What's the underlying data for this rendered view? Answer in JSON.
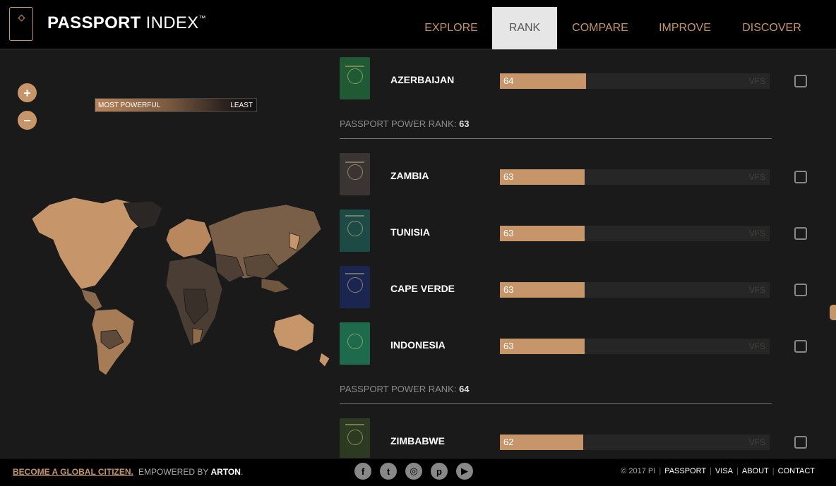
{
  "header": {
    "logo_bold": "PASSPORT",
    "logo_light": "INDEX",
    "logo_tm": "™",
    "nav": [
      {
        "label": "EXPLORE",
        "active": false
      },
      {
        "label": "RANK",
        "active": true
      },
      {
        "label": "COMPARE",
        "active": false
      },
      {
        "label": "IMPROVE",
        "active": false
      },
      {
        "label": "DISCOVER",
        "active": false
      }
    ]
  },
  "map": {
    "zoom_in": "+",
    "zoom_out": "−",
    "legend_most": "MOST POWERFUL",
    "legend_least": "LEAST"
  },
  "list": {
    "rank_label": "PASSPORT POWER RANK:",
    "bar_suffix": "VFS",
    "rows": [
      {
        "country": "AZERBAIJAN",
        "score": "64",
        "fill": 0.32,
        "passport_color": "#1f5a34"
      },
      {
        "country": "ZAMBIA",
        "score": "63",
        "fill": 0.315,
        "passport_color": "#3a3532"
      },
      {
        "country": "TUNISIA",
        "score": "63",
        "fill": 0.315,
        "passport_color": "#1e4a46"
      },
      {
        "country": "CAPE VERDE",
        "score": "63",
        "fill": 0.315,
        "passport_color": "#1b2650"
      },
      {
        "country": "INDONESIA",
        "score": "63",
        "fill": 0.315,
        "passport_color": "#1e6a4c"
      },
      {
        "country": "ZIMBABWE",
        "score": "62",
        "fill": 0.31,
        "passport_color": "#2c3a22"
      }
    ],
    "ranks": [
      "63",
      "64"
    ]
  },
  "footer": {
    "become": "BECOME A GLOBAL CITIZEN.",
    "empowered": "EMPOWERED BY",
    "arton": "ARTON",
    "dot": ".",
    "social": [
      {
        "icon": "facebook-icon",
        "glyph": "f"
      },
      {
        "icon": "twitter-icon",
        "glyph": "t"
      },
      {
        "icon": "instagram-icon",
        "glyph": "◎"
      },
      {
        "icon": "pinterest-icon",
        "glyph": "p"
      },
      {
        "icon": "youtube-icon",
        "glyph": "▶"
      }
    ],
    "copyright": "© 2017 PI",
    "links": [
      "PASSPORT",
      "VISA",
      "ABOUT",
      "CONTACT"
    ]
  },
  "colors": {
    "accent": "#c7956a",
    "background": "#1a1a1a"
  }
}
